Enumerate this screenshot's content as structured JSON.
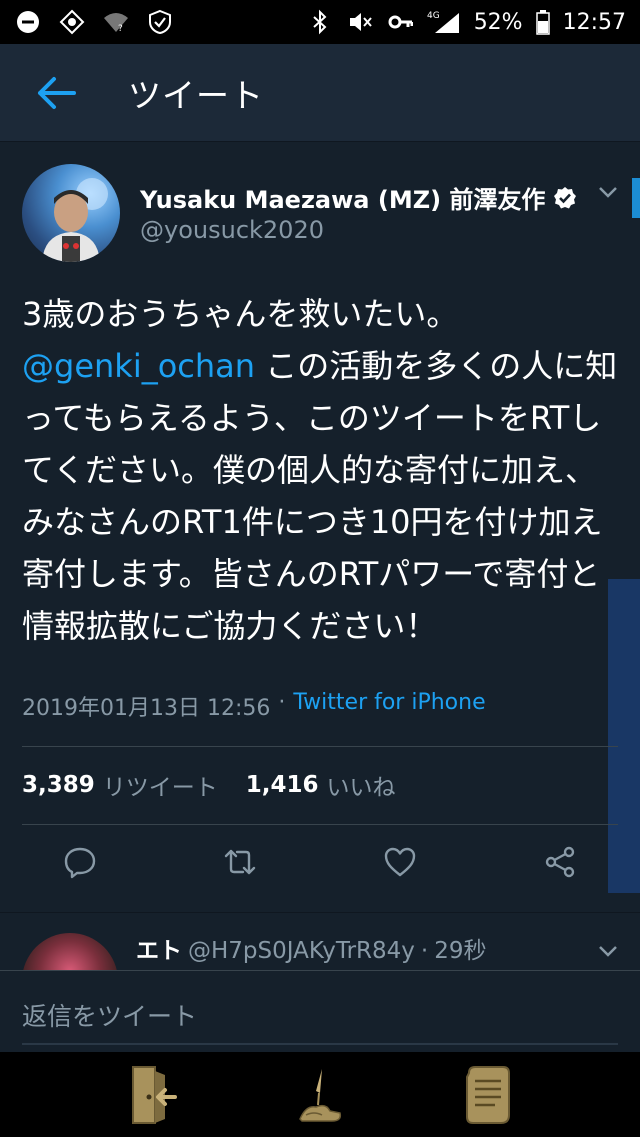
{
  "status_bar": {
    "network_label": "4G",
    "battery": "52%",
    "time": "12:57"
  },
  "header": {
    "title": "ツイート"
  },
  "tweet": {
    "author_name": "Yusaku Maezawa (MZ) 前澤友作",
    "author_handle": "@yousuck2020",
    "text_part1": "3歳のおうちゃんを救いたい。",
    "mention": "@genki_ochan",
    "text_part2": " この活動を多くの人に知ってもらえるよう、このツイートをRTしてください。僕の個人的な寄付に加え、みなさんのRT1件につき10円を付け加え寄付します。皆さんのRTパワーで寄付と情報拡散にご協力ください！",
    "timestamp": "2019年01月13日 12:56",
    "separator": "·",
    "source": "Twitter for iPhone",
    "retweet_count": "3,389",
    "retweet_label": "リツイート",
    "like_count": "1,416",
    "like_label": "いいね"
  },
  "reply": {
    "name": "エト",
    "handle": "@H7pS0JAKyTrR84y",
    "time_sep": "·",
    "time": "29秒"
  },
  "compose": {
    "placeholder": "返信をツイート"
  },
  "colors": {
    "background": "#15202b",
    "header": "#1c2938",
    "accent": "#1da1f2",
    "muted": "#8899a6"
  }
}
